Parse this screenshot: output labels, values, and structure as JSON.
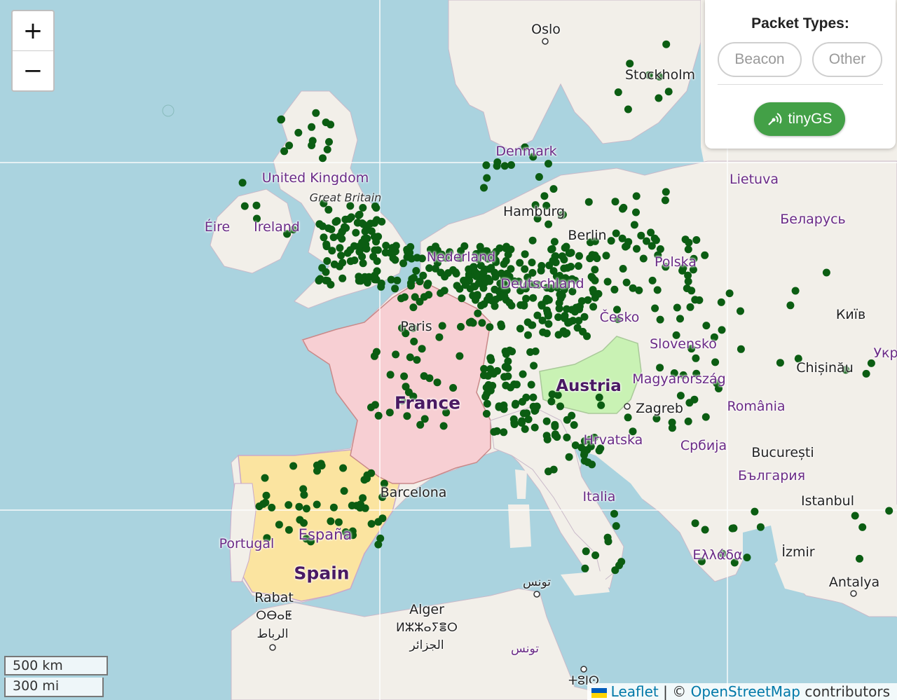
{
  "panel": {
    "title": "Packet Types:",
    "beacon_label": "Beacon",
    "other_label": "Other",
    "station_label": "tinyGS"
  },
  "zoom": {
    "in_label": "+",
    "out_label": "−"
  },
  "scale": {
    "km": "500 km",
    "mi": "300 mi"
  },
  "attribution": {
    "leaflet": "Leaflet",
    "separator": "| ©",
    "osm": "OpenStreetMap",
    "contributors": "contributors"
  },
  "colors": {
    "sea": "#aad3df",
    "land": "#f2efe9",
    "france": "#f7cfd3",
    "spain": "#fbe4a0",
    "austria": "#c9f2b4",
    "station_marker": "#0b5d12",
    "tinygs_button": "#43a047"
  },
  "labels": {
    "oslo": "Oslo",
    "stockholm": "Stockholm",
    "denmark": "Denmark",
    "lietuva": "Lietuva",
    "united_kingdom": "United Kingdom",
    "great_britain": "Great Britain",
    "eire": "Éire",
    "ireland": "Ireland",
    "hamburg": "Hamburg",
    "berlin": "Berlin",
    "belarus": "Беларусь",
    "nederland": "Nederland",
    "polska": "Polska",
    "deutschland": "Deutschland",
    "kyiv": "Київ",
    "paris": "Paris",
    "cesko": "Česko",
    "slovensko": "Slovensko",
    "ukr": "Укр",
    "chisinau": "Chișinău",
    "austria": "Austria",
    "magyarorszag": "Magyarország",
    "france": "France",
    "zagreb": "Zagreb",
    "romania": "România",
    "hrvatska": "Hrvatska",
    "srbija": "Србија",
    "bucuresti": "București",
    "bulgaria": "България",
    "barcelona": "Barcelona",
    "italia": "Italia",
    "istanbul": "Istanbul",
    "espana": "España",
    "portugal": "Portugal",
    "ellada": "Ελλάδα",
    "izmir": "İzmir",
    "spain": "Spain",
    "tunis_ar": "تونس",
    "antalya": "Antalya",
    "rabat": "Rabat",
    "alger": "Alger",
    "rabat_tif": "ⵔⴱⴰⵟ",
    "alger_tif": "ⵍⵣⵣⴰⵢⴻⵔ",
    "rabat_ar": "الرباط",
    "alger_ar": "الجزائر",
    "tunis_ar2": "تونس",
    "tunis_tif": "ⵜⵓⵏⵙ"
  }
}
